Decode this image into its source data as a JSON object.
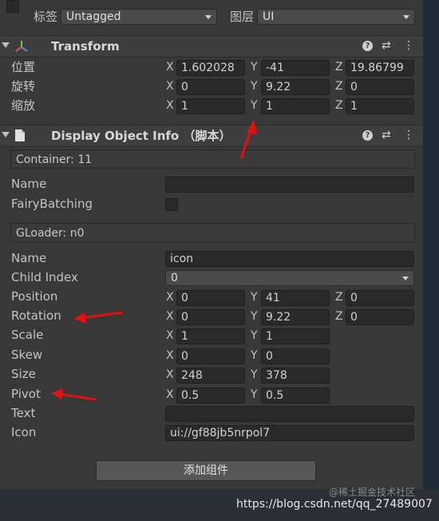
{
  "tag_row": {
    "tag_label": "标签",
    "tag_value": "Untagged",
    "layer_label": "图层",
    "layer_value": "UI"
  },
  "transform": {
    "title": "Transform",
    "rows": [
      {
        "label": "位置",
        "x": "1.602028",
        "y": "-41",
        "z": "19.86799"
      },
      {
        "label": "旋转",
        "x": "0",
        "y": "9.22",
        "z": "0"
      },
      {
        "label": "缩放",
        "x": "1",
        "y": "1",
        "z": "1"
      }
    ]
  },
  "axes": {
    "x": "X",
    "y": "Y",
    "z": "Z"
  },
  "display_info": {
    "title": "Display Object Info （脚本）",
    "container": "Container: 11",
    "name_label": "Name",
    "name_value": "",
    "batching_label": "FairyBatching",
    "gloader": "GLoader: n0",
    "fields": {
      "name_label": "Name",
      "name_value": "icon",
      "child_index_label": "Child Index",
      "child_index_value": "0",
      "position_label": "Position",
      "position": {
        "x": "0",
        "y": "41",
        "z": "0"
      },
      "rotation_label": "Rotation",
      "rotation": {
        "x": "0",
        "y": "9.22",
        "z": "0"
      },
      "scale_label": "Scale",
      "scale": {
        "x": "1",
        "y": "1"
      },
      "skew_label": "Skew",
      "skew": {
        "x": "0",
        "y": "0"
      },
      "size_label": "Size",
      "size": {
        "x": "248",
        "y": "378"
      },
      "pivot_label": "Pivot",
      "pivot": {
        "x": "0.5",
        "y": "0.5"
      },
      "text_label": "Text",
      "text_value": "",
      "icon_label": "Icon",
      "icon_value": "ui://gf88jb5nrpol7"
    }
  },
  "add_component": "添加组件",
  "watermark": "https://blog.csdn.net/qq_27489007",
  "watermark_faint": "@稀土掘金技术社区",
  "colors": {
    "panel": "#383838",
    "field": "#2a2a2a",
    "header": "#3e3e3e",
    "arrow": "#e11111"
  }
}
